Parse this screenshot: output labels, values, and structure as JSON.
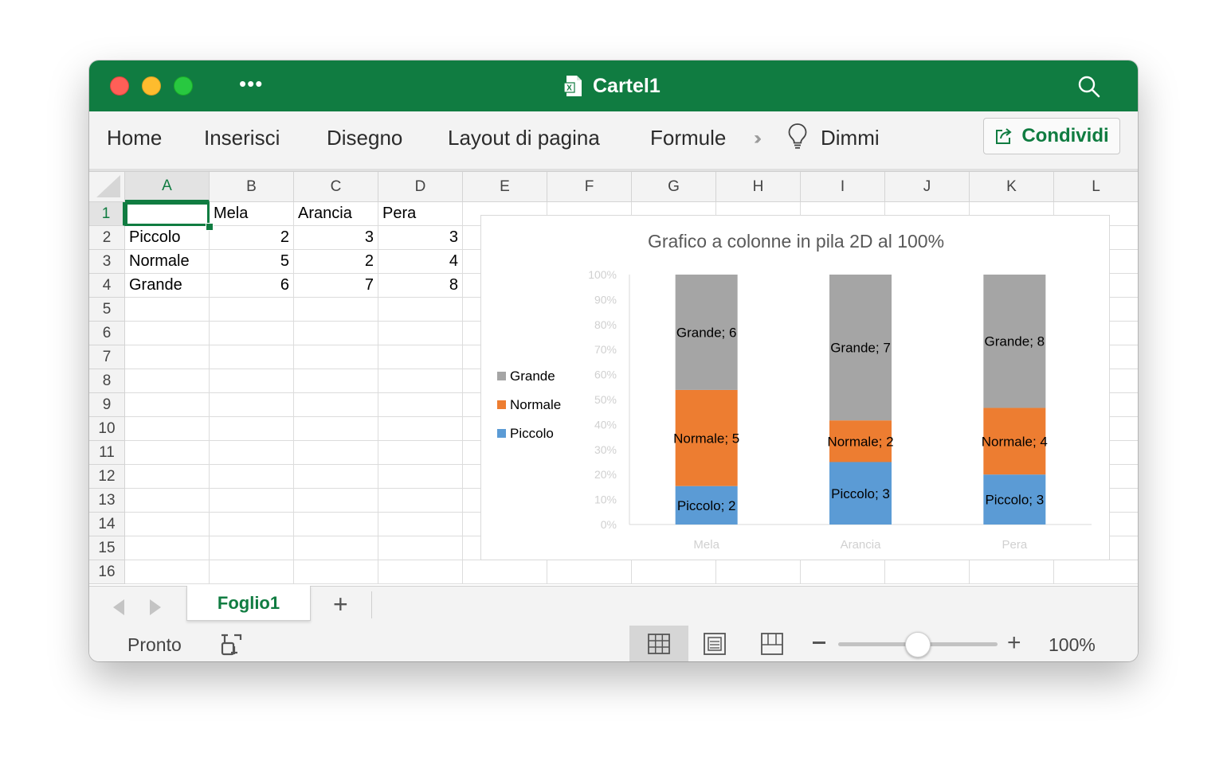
{
  "window": {
    "title": "Cartel1"
  },
  "ribbon": {
    "tabs": [
      "Home",
      "Inserisci",
      "Disegno",
      "Layout di pagina",
      "Formule"
    ],
    "tell_me": "Dimmi",
    "share_label": "Condividi"
  },
  "sheet": {
    "columns": [
      "A",
      "B",
      "C",
      "D",
      "E",
      "F",
      "G",
      "H",
      "I",
      "J",
      "K",
      "L"
    ],
    "rows": [
      "1",
      "2",
      "3",
      "4",
      "5",
      "6",
      "7",
      "8",
      "9",
      "10",
      "11",
      "12",
      "13",
      "14",
      "15",
      "16"
    ],
    "selected_column": "A",
    "selected_row": "1",
    "cells": [
      [
        "",
        "Mela",
        "Arancia",
        "Pera"
      ],
      [
        "Piccolo",
        "2",
        "3",
        "3"
      ],
      [
        "Normale",
        "5",
        "2",
        "4"
      ],
      [
        "Grande",
        "6",
        "7",
        "8"
      ]
    ]
  },
  "chart_data": {
    "type": "bar",
    "stacked": "percent",
    "title": "Grafico a colonne in pila 2D al 100%",
    "categories": [
      "Mela",
      "Arancia",
      "Pera"
    ],
    "series": [
      {
        "name": "Piccolo",
        "values": [
          2,
          3,
          3
        ],
        "color": "#5b9bd5"
      },
      {
        "name": "Normale",
        "values": [
          5,
          2,
          4
        ],
        "color": "#ed7d31"
      },
      {
        "name": "Grande",
        "values": [
          6,
          7,
          8
        ],
        "color": "#a5a5a5"
      }
    ],
    "y_ticks": [
      "0%",
      "10%",
      "20%",
      "30%",
      "40%",
      "50%",
      "60%",
      "70%",
      "80%",
      "90%",
      "100%"
    ],
    "ylim": [
      0,
      100
    ],
    "legend": "left",
    "legend_order": [
      "Grande",
      "Normale",
      "Piccolo"
    ],
    "data_labels": true,
    "grid": false
  },
  "sheet_tabs": {
    "active": "Foglio1"
  },
  "status": {
    "ready": "Pronto",
    "zoom": "100%"
  }
}
